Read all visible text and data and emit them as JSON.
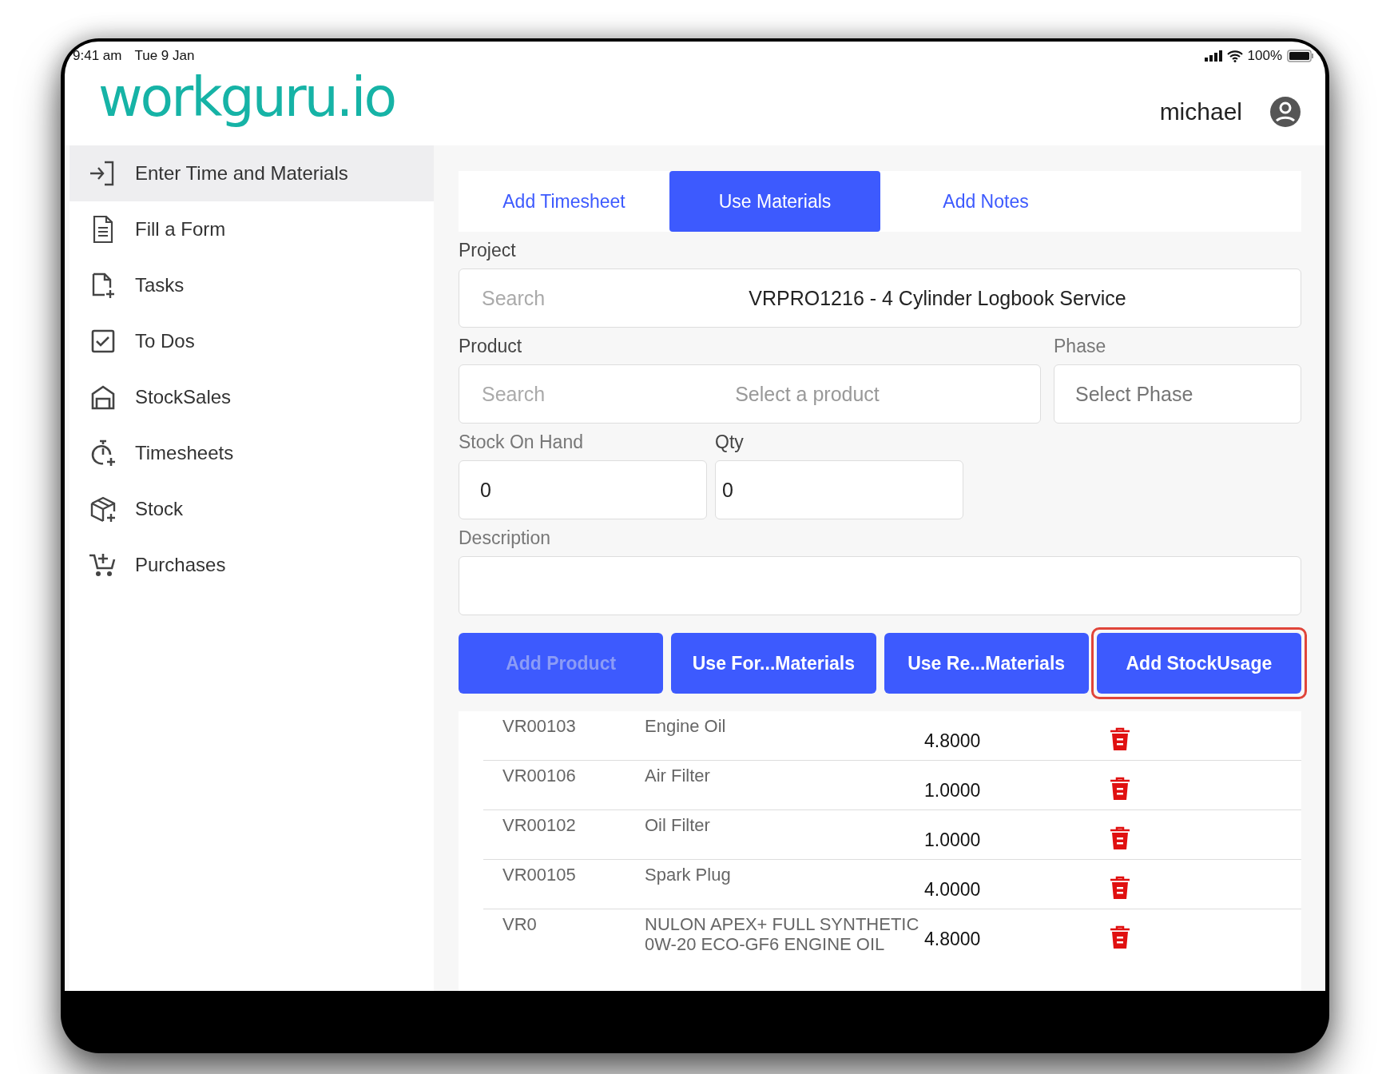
{
  "status_bar": {
    "time": "9:41 am",
    "date": "Tue 9 Jan",
    "battery": "100%"
  },
  "header": {
    "logo": "workguru.io",
    "user": "michael"
  },
  "sidebar": {
    "items": [
      {
        "label": "Enter Time and Materials",
        "selected": true
      },
      {
        "label": "Fill a Form",
        "selected": false
      },
      {
        "label": "Tasks",
        "selected": false
      },
      {
        "label": "To Dos",
        "selected": false
      },
      {
        "label": "StockSales",
        "selected": false
      },
      {
        "label": "Timesheets",
        "selected": false
      },
      {
        "label": "Stock",
        "selected": false
      },
      {
        "label": "Purchases",
        "selected": false
      }
    ]
  },
  "tabs": [
    {
      "label": "Add Timesheet",
      "selected": false
    },
    {
      "label": "Use Materials",
      "selected": true
    },
    {
      "label": "Add Notes",
      "selected": false
    }
  ],
  "form": {
    "project": {
      "label": "Project",
      "placeholder": "Search",
      "value": "VRPRO1216 - 4 Cylinder Logbook Service"
    },
    "product": {
      "label": "Product",
      "placeholder": "Search",
      "prompt": "Select a product"
    },
    "phase": {
      "label": "Phase",
      "placeholder": "Select Phase"
    },
    "stock_on_hand": {
      "label": "Stock On Hand",
      "value": "0"
    },
    "qty": {
      "label": "Qty",
      "value": "0"
    },
    "description": {
      "label": "Description"
    }
  },
  "buttons": [
    {
      "label": "Add Product",
      "disabled": true,
      "highlighted": false
    },
    {
      "label": "Use For...Materials",
      "disabled": false,
      "highlighted": false
    },
    {
      "label": "Use Re...Materials",
      "disabled": false,
      "highlighted": false
    },
    {
      "label": "Add StockUsage",
      "disabled": false,
      "highlighted": true
    }
  ],
  "materials": [
    {
      "code": "VR00103",
      "name": "Engine Oil",
      "qty": "4.8000"
    },
    {
      "code": "VR00106",
      "name": "Air Filter",
      "qty": "1.0000"
    },
    {
      "code": "VR00102",
      "name": "Oil Filter",
      "qty": "1.0000"
    },
    {
      "code": "VR00105",
      "name": "Spark Plug",
      "qty": "4.0000"
    },
    {
      "code": "VR0",
      "name": "NULON APEX+ FULL SYNTHETIC 0W-20 ECO-GF6 ENGINE OIL",
      "qty": "4.8000"
    }
  ]
}
